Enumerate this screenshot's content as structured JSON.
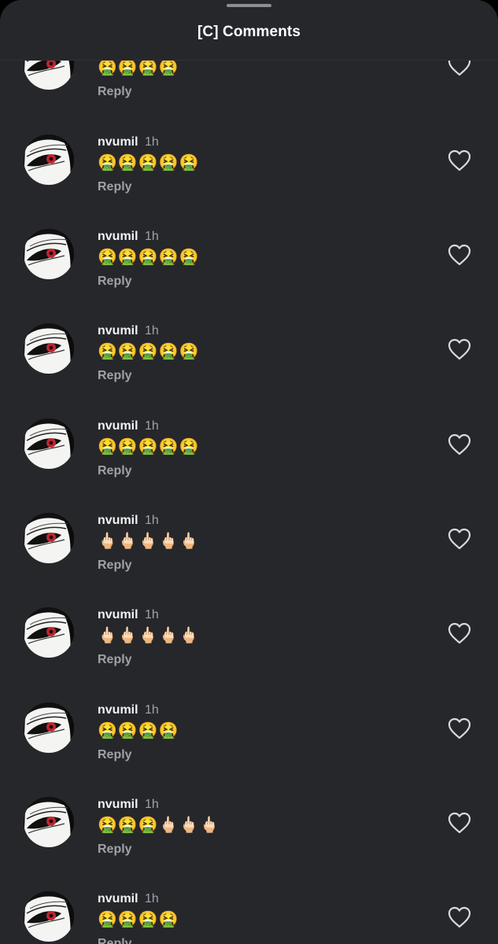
{
  "header": {
    "title": "[C] Comments"
  },
  "comments": [
    {
      "username": "",
      "time": "",
      "text": "🤮🤮🤮🤮",
      "reply_label": "Reply"
    },
    {
      "username": "nvumil",
      "time": "1h",
      "text": "🤮🤮🤮🤮🤮",
      "reply_label": "Reply"
    },
    {
      "username": "nvumil",
      "time": "1h",
      "text": "🤮🤮🤮🤮🤮",
      "reply_label": "Reply"
    },
    {
      "username": "nvumil",
      "time": "1h",
      "text": "🤮🤮🤮🤮🤮",
      "reply_label": "Reply"
    },
    {
      "username": "nvumil",
      "time": "1h",
      "text": "🤮🤮🤮🤮🤮",
      "reply_label": "Reply"
    },
    {
      "username": "nvumil",
      "time": "1h",
      "text": "🖕🏻🖕🏻🖕🏻🖕🏻🖕🏻",
      "reply_label": "Reply"
    },
    {
      "username": "nvumil",
      "time": "1h",
      "text": "🖕🏻🖕🏻🖕🏻🖕🏻🖕🏻",
      "reply_label": "Reply"
    },
    {
      "username": "nvumil",
      "time": "1h",
      "text": "🤮🤮🤮🤮",
      "reply_label": "Reply"
    },
    {
      "username": "nvumil",
      "time": "1h",
      "text": "🤮🤮🤮🖕🏻🖕🏻🖕🏻",
      "reply_label": "Reply"
    },
    {
      "username": "nvumil",
      "time": "1h",
      "text": "🤮🤮🤮🤮",
      "reply_label": "Reply"
    }
  ],
  "icons": {
    "like": "heart-outline-icon",
    "avatar": "masked-face-avatar"
  },
  "colors": {
    "background": "#25272b",
    "text_primary": "#f2f2f2",
    "text_secondary": "#9ea2a8",
    "heart_outline": "#d9dadc"
  }
}
